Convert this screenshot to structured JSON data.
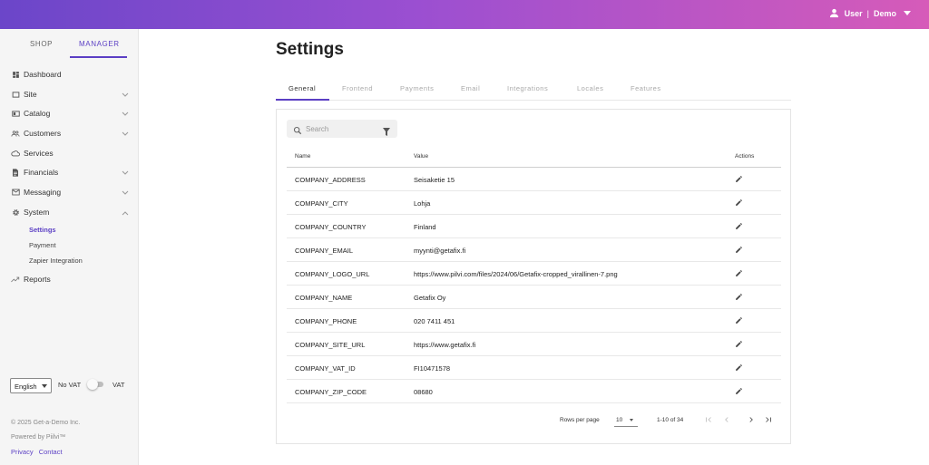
{
  "header": {
    "user_label": "User",
    "separator": "|",
    "user_name": "Demo"
  },
  "sidebar": {
    "tabs": [
      "SHOP",
      "MANAGER"
    ],
    "active_tab": "MANAGER",
    "nav": [
      {
        "label": "Dashboard",
        "icon": "dashboard-icon"
      },
      {
        "label": "Site",
        "icon": "site-icon"
      },
      {
        "label": "Catalog",
        "icon": "catalog-icon"
      },
      {
        "label": "Customers",
        "icon": "customers-icon"
      },
      {
        "label": "Services",
        "icon": "cloud-icon"
      },
      {
        "label": "Financials",
        "icon": "document-icon"
      },
      {
        "label": "Messaging",
        "icon": "mail-icon"
      },
      {
        "label": "System",
        "icon": "gear-icon"
      }
    ],
    "system_sub": [
      {
        "label": "Settings",
        "active": true
      },
      {
        "label": "Payment"
      },
      {
        "label": "Zapier Integration"
      }
    ],
    "reports": {
      "label": "Reports",
      "icon": "trending-up-icon"
    },
    "language": "English",
    "no_vat_label": "No VAT",
    "vat_label": "VAT",
    "vat_enabled": false,
    "copyright": "© 2025 Get-a-Demo Inc.",
    "powered_by": "Powered by Piilvi™",
    "privacy_link": "Privacy",
    "contact_link": "Contact"
  },
  "page": {
    "title": "Settings",
    "tabs": [
      "General",
      "Frontend",
      "Payments",
      "Email",
      "Integrations",
      "Locales",
      "Features"
    ],
    "active_tab": "General"
  },
  "table": {
    "search_placeholder": "Search",
    "columns": [
      "Name",
      "Value",
      "Actions"
    ],
    "rows": [
      {
        "name": "COMPANY_ADDRESS",
        "value": "Seisaketie 15"
      },
      {
        "name": "COMPANY_CITY",
        "value": "Lohja"
      },
      {
        "name": "COMPANY_COUNTRY",
        "value": "Finland"
      },
      {
        "name": "COMPANY_EMAIL",
        "value": "myynti@getafix.fi"
      },
      {
        "name": "COMPANY_LOGO_URL",
        "value": "https://www.pilvi.com/files/2024/06/Getafix-cropped_virallinen-7.png"
      },
      {
        "name": "COMPANY_NAME",
        "value": "Getafix Oy"
      },
      {
        "name": "COMPANY_PHONE",
        "value": "020 7411 451"
      },
      {
        "name": "COMPANY_SITE_URL",
        "value": "https://www.getafix.fi"
      },
      {
        "name": "COMPANY_VAT_ID",
        "value": "FI10471578"
      },
      {
        "name": "COMPANY_ZIP_CODE",
        "value": "08680"
      }
    ],
    "pagination": {
      "rows_per_page_label": "Rows per page",
      "rows_per_page": "10",
      "range": "1-10 of 34"
    }
  },
  "colors": {
    "accent": "#5b3fc4",
    "gradient_start": "#6b46c9",
    "gradient_end": "#d65bb9"
  }
}
